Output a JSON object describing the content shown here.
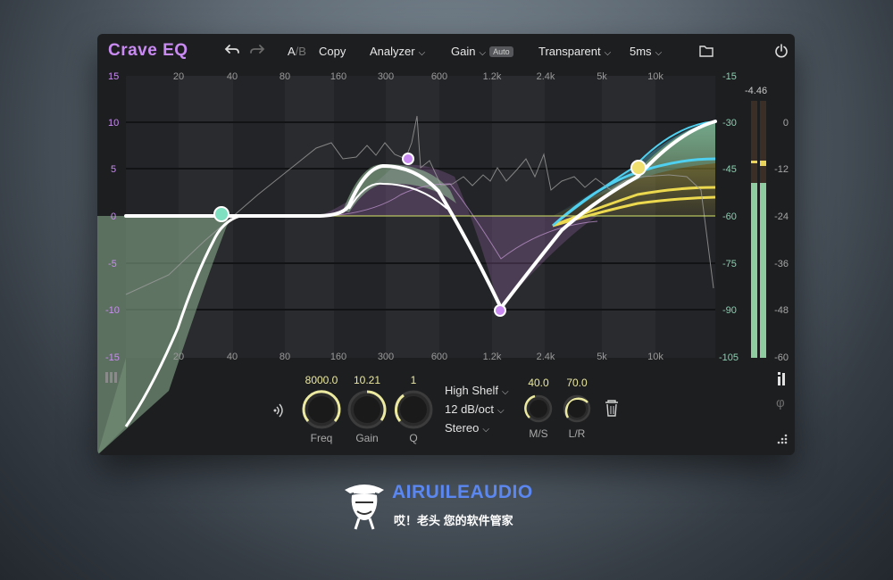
{
  "app": {
    "title": "Crave EQ",
    "ab_a": "A",
    "ab_sep": "/",
    "ab_b": "B",
    "copy_label": "Copy",
    "analyzer_label": "Analyzer",
    "gain_label": "Gain",
    "auto_badge": "Auto",
    "mode_label": "Transparent",
    "latency_label": "5ms"
  },
  "graph": {
    "freq_labels": [
      "20",
      "40",
      "80",
      "160",
      "300",
      "600",
      "1.2k",
      "2.4k",
      "5k",
      "10k"
    ],
    "gain_labels": [
      "15",
      "10",
      "5",
      "0",
      "-5",
      "-10",
      "-15"
    ],
    "analyzer_db_labels": [
      "-15",
      "-30",
      "-45",
      "-60",
      "-75",
      "-90",
      "-105"
    ],
    "meter_peak": "-4.46",
    "meter_scale": [
      "0",
      "-12",
      "-24",
      "-36",
      "-48",
      "-60"
    ],
    "meter_level": 0.68
  },
  "controls": {
    "freq": {
      "label": "Freq",
      "value": "8000.0"
    },
    "gain": {
      "label": "Gain",
      "value": "10.21"
    },
    "q": {
      "label": "Q",
      "value": "1"
    },
    "filter_type": "High Shelf",
    "slope": "12 dB/oct",
    "channel": "Stereo",
    "ms": {
      "label": "M/S",
      "value": "40.0"
    },
    "lr": {
      "label": "L/R",
      "value": "70.0"
    }
  },
  "colors": {
    "accent_purple": "#c98bf2",
    "knob_yellow": "#ece9a0",
    "node_green": "#7ee0c0",
    "node_cyan": "#4fd0f0",
    "node_yellow": "#f0e070"
  },
  "watermark": {
    "brand": "AIRUILEAUDIO",
    "subtitle": "哎！老头 您的软件管家"
  }
}
